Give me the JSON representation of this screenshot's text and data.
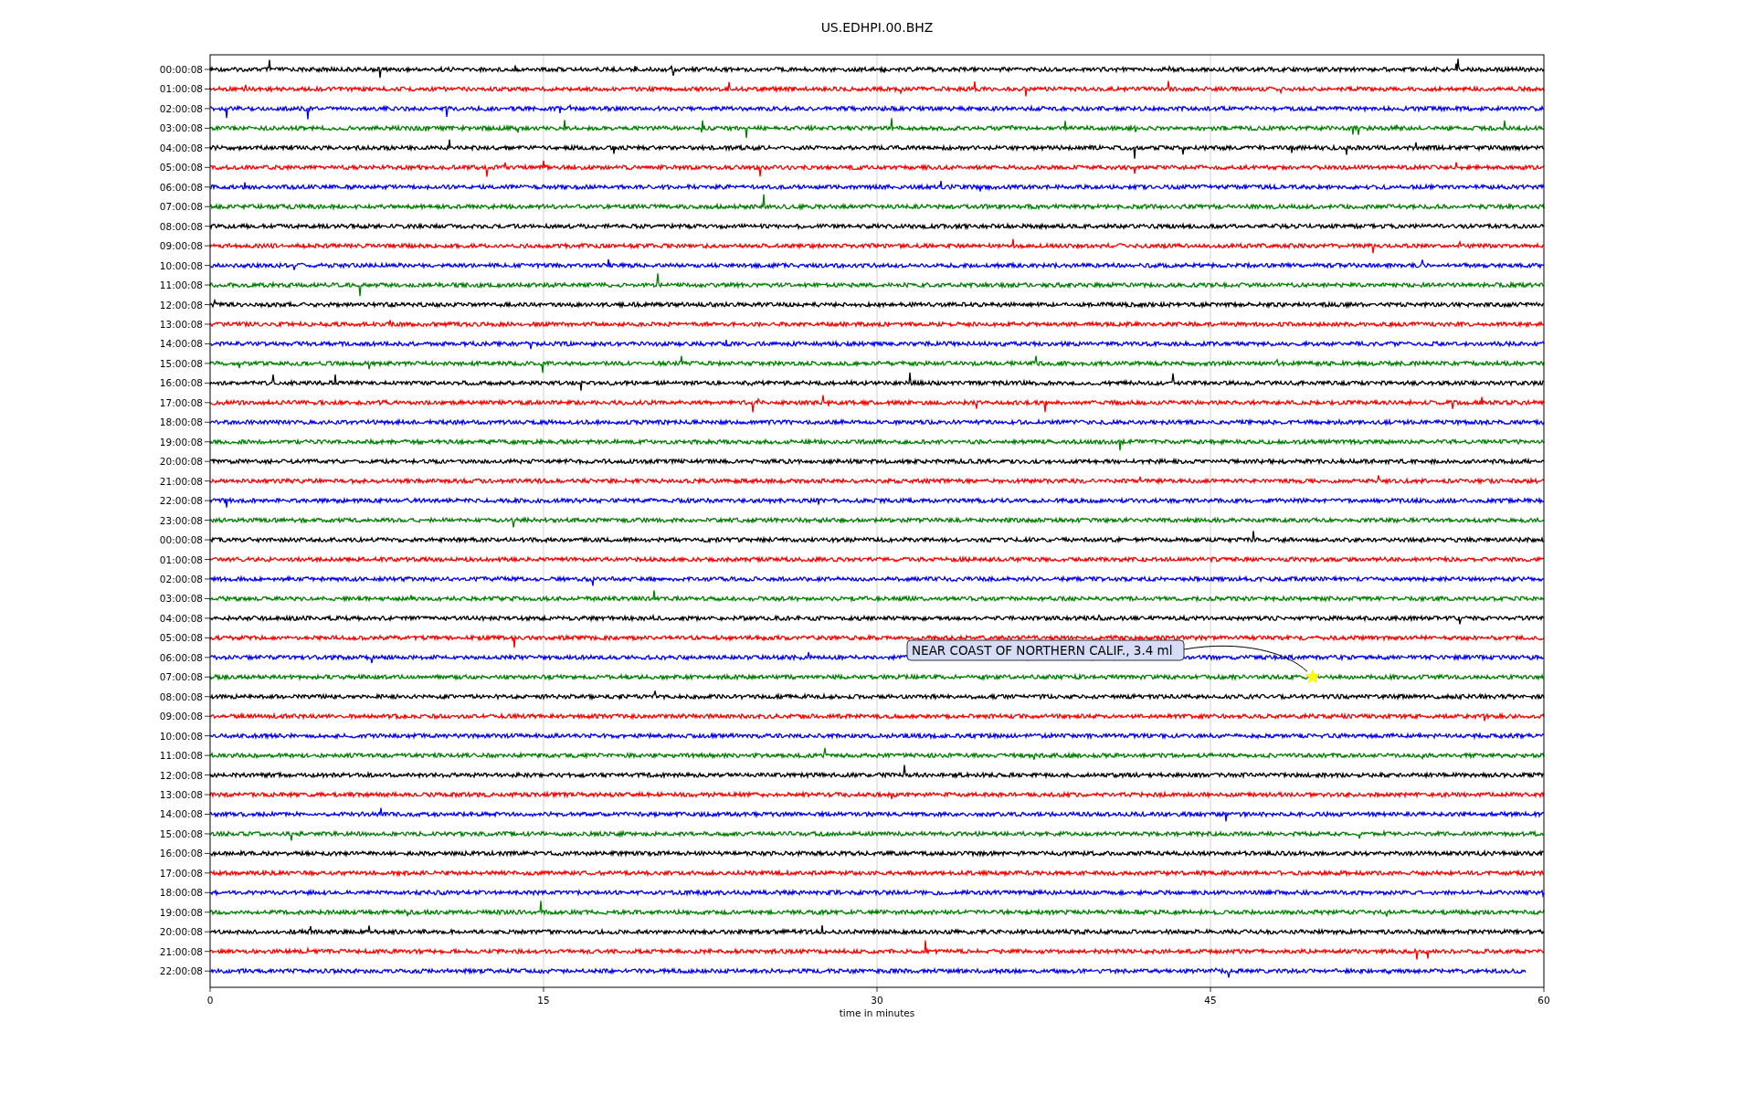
{
  "plot": {
    "title": "US.EDHPI.00.BHZ",
    "xlabel": "time in minutes",
    "xticks": [
      "0",
      "15",
      "30",
      "45",
      "60"
    ],
    "annotation": {
      "text": "NEAR COAST OF NORTHERN CALIF., 3.4 ml"
    },
    "rows": [
      {
        "label": "00:00:08",
        "color": "#000000"
      },
      {
        "label": "01:00:08",
        "color": "#ff0000"
      },
      {
        "label": "02:00:08",
        "color": "#0000ff"
      },
      {
        "label": "03:00:08",
        "color": "#008000"
      },
      {
        "label": "04:00:08",
        "color": "#000000"
      },
      {
        "label": "05:00:08",
        "color": "#ff0000"
      },
      {
        "label": "06:00:08",
        "color": "#0000ff"
      },
      {
        "label": "07:00:08",
        "color": "#008000"
      },
      {
        "label": "08:00:08",
        "color": "#000000"
      },
      {
        "label": "09:00:08",
        "color": "#ff0000"
      },
      {
        "label": "10:00:08",
        "color": "#0000ff"
      },
      {
        "label": "11:00:08",
        "color": "#008000"
      },
      {
        "label": "12:00:08",
        "color": "#000000"
      },
      {
        "label": "13:00:08",
        "color": "#ff0000"
      },
      {
        "label": "14:00:08",
        "color": "#0000ff"
      },
      {
        "label": "15:00:08",
        "color": "#008000"
      },
      {
        "label": "16:00:08",
        "color": "#000000"
      },
      {
        "label": "17:00:08",
        "color": "#ff0000"
      },
      {
        "label": "18:00:08",
        "color": "#0000ff"
      },
      {
        "label": "19:00:08",
        "color": "#008000"
      },
      {
        "label": "20:00:08",
        "color": "#000000"
      },
      {
        "label": "21:00:08",
        "color": "#ff0000"
      },
      {
        "label": "22:00:08",
        "color": "#0000ff"
      },
      {
        "label": "23:00:08",
        "color": "#008000"
      },
      {
        "label": "00:00:08",
        "color": "#000000"
      },
      {
        "label": "01:00:08",
        "color": "#ff0000"
      },
      {
        "label": "02:00:08",
        "color": "#0000ff"
      },
      {
        "label": "03:00:08",
        "color": "#008000"
      },
      {
        "label": "04:00:08",
        "color": "#000000"
      },
      {
        "label": "05:00:08",
        "color": "#ff0000"
      },
      {
        "label": "06:00:08",
        "color": "#0000ff"
      },
      {
        "label": "07:00:08",
        "color": "#008000"
      },
      {
        "label": "08:00:08",
        "color": "#000000"
      },
      {
        "label": "09:00:08",
        "color": "#ff0000"
      },
      {
        "label": "10:00:08",
        "color": "#0000ff"
      },
      {
        "label": "11:00:08",
        "color": "#008000"
      },
      {
        "label": "12:00:08",
        "color": "#000000"
      },
      {
        "label": "13:00:08",
        "color": "#ff0000"
      },
      {
        "label": "14:00:08",
        "color": "#0000ff"
      },
      {
        "label": "15:00:08",
        "color": "#008000"
      },
      {
        "label": "16:00:08",
        "color": "#000000"
      },
      {
        "label": "17:00:08",
        "color": "#ff0000"
      },
      {
        "label": "18:00:08",
        "color": "#0000ff"
      },
      {
        "label": "19:00:08",
        "color": "#008000"
      },
      {
        "label": "20:00:08",
        "color": "#000000"
      },
      {
        "label": "21:00:08",
        "color": "#ff0000"
      },
      {
        "label": "22:00:08",
        "color": "#0000ff"
      }
    ]
  }
}
